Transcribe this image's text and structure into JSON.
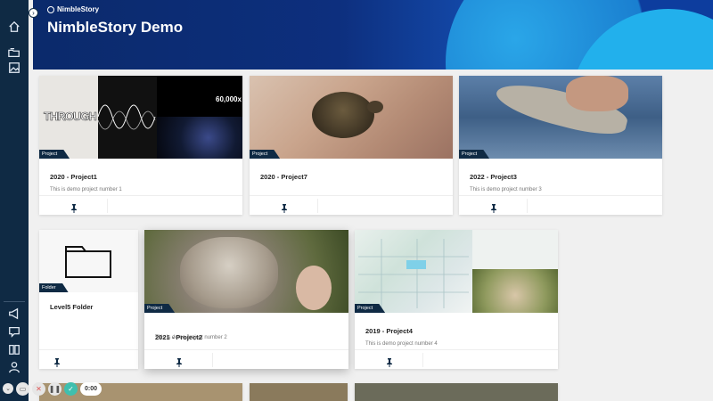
{
  "header": {
    "logo_text": "NimbleStory",
    "title": "NimbleStory Demo"
  },
  "sidebar": {
    "top_icons": [
      "home-icon",
      "folders-icon",
      "gallery-icon"
    ],
    "bottom_icons": [
      "announcement-icon",
      "guide-icon",
      "library-icon",
      "user-icon"
    ]
  },
  "cards": [
    {
      "type": "Project",
      "title": "2020 - Project1",
      "desc": "This is demo project number 1"
    },
    {
      "type": "Project",
      "title": "2020 - Project7",
      "desc": ""
    },
    {
      "type": "Project",
      "title": "2022 - Project3",
      "desc": "This is demo project number 3"
    },
    {
      "type": "Folder",
      "title": "Level5 Folder",
      "desc": ""
    },
    {
      "type": "Project",
      "title": "2021 - Project2",
      "desc": "This is demo project number 2"
    },
    {
      "type": "Project",
      "title": "2019 - Project4",
      "desc": "This is demo project number 4"
    }
  ],
  "thumb_text": {
    "through": "THROUGH",
    "stat": "60,000x"
  },
  "recorder": {
    "time": "0:00"
  },
  "colors": {
    "sidebar": "#0f2a44",
    "accent": "#3fbfae"
  }
}
